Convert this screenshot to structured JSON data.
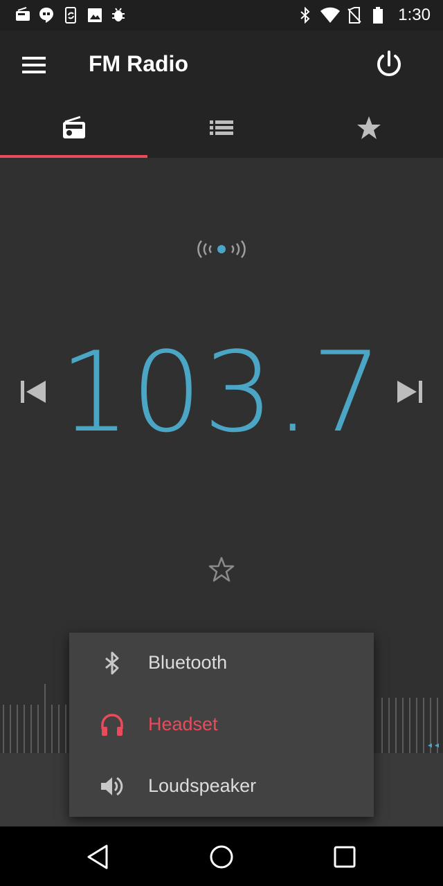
{
  "status_bar": {
    "time": "1:30",
    "left_icons": [
      "radio-notification-icon",
      "hangouts-icon",
      "phone-sync-icon",
      "image-icon",
      "bug-icon"
    ],
    "right_icons": [
      "bluetooth-icon",
      "wifi-icon",
      "no-sim-icon",
      "battery-icon"
    ]
  },
  "app_bar": {
    "title": "FM Radio",
    "menu_icon": "hamburger-menu-icon",
    "power_icon": "power-icon"
  },
  "tabs": [
    {
      "name": "radio",
      "icon": "radio-icon",
      "selected": true
    },
    {
      "name": "station-list",
      "icon": "list-icon",
      "selected": false
    },
    {
      "name": "favorites",
      "icon": "star-icon",
      "selected": false
    }
  ],
  "player": {
    "frequency": "103.7",
    "signal_icon": "signal-broadcast-icon",
    "prev_icon": "skip-previous-icon",
    "next_icon": "skip-next-icon",
    "favorite_icon": "star-outline-icon",
    "favorite": false
  },
  "audio_output_menu": {
    "items": [
      {
        "label": "Bluetooth",
        "icon": "bluetooth-icon",
        "selected": false
      },
      {
        "label": "Headset",
        "icon": "headphones-icon",
        "selected": true
      },
      {
        "label": "Loudspeaker",
        "icon": "speaker-icon",
        "selected": false
      }
    ]
  },
  "colors": {
    "accent": "#e84b5c",
    "frequency": "#4aa6c4",
    "background": "#303030",
    "app_bar": "#242424"
  },
  "nav_bar": {
    "buttons": [
      "back-icon",
      "home-icon",
      "recents-icon"
    ]
  }
}
